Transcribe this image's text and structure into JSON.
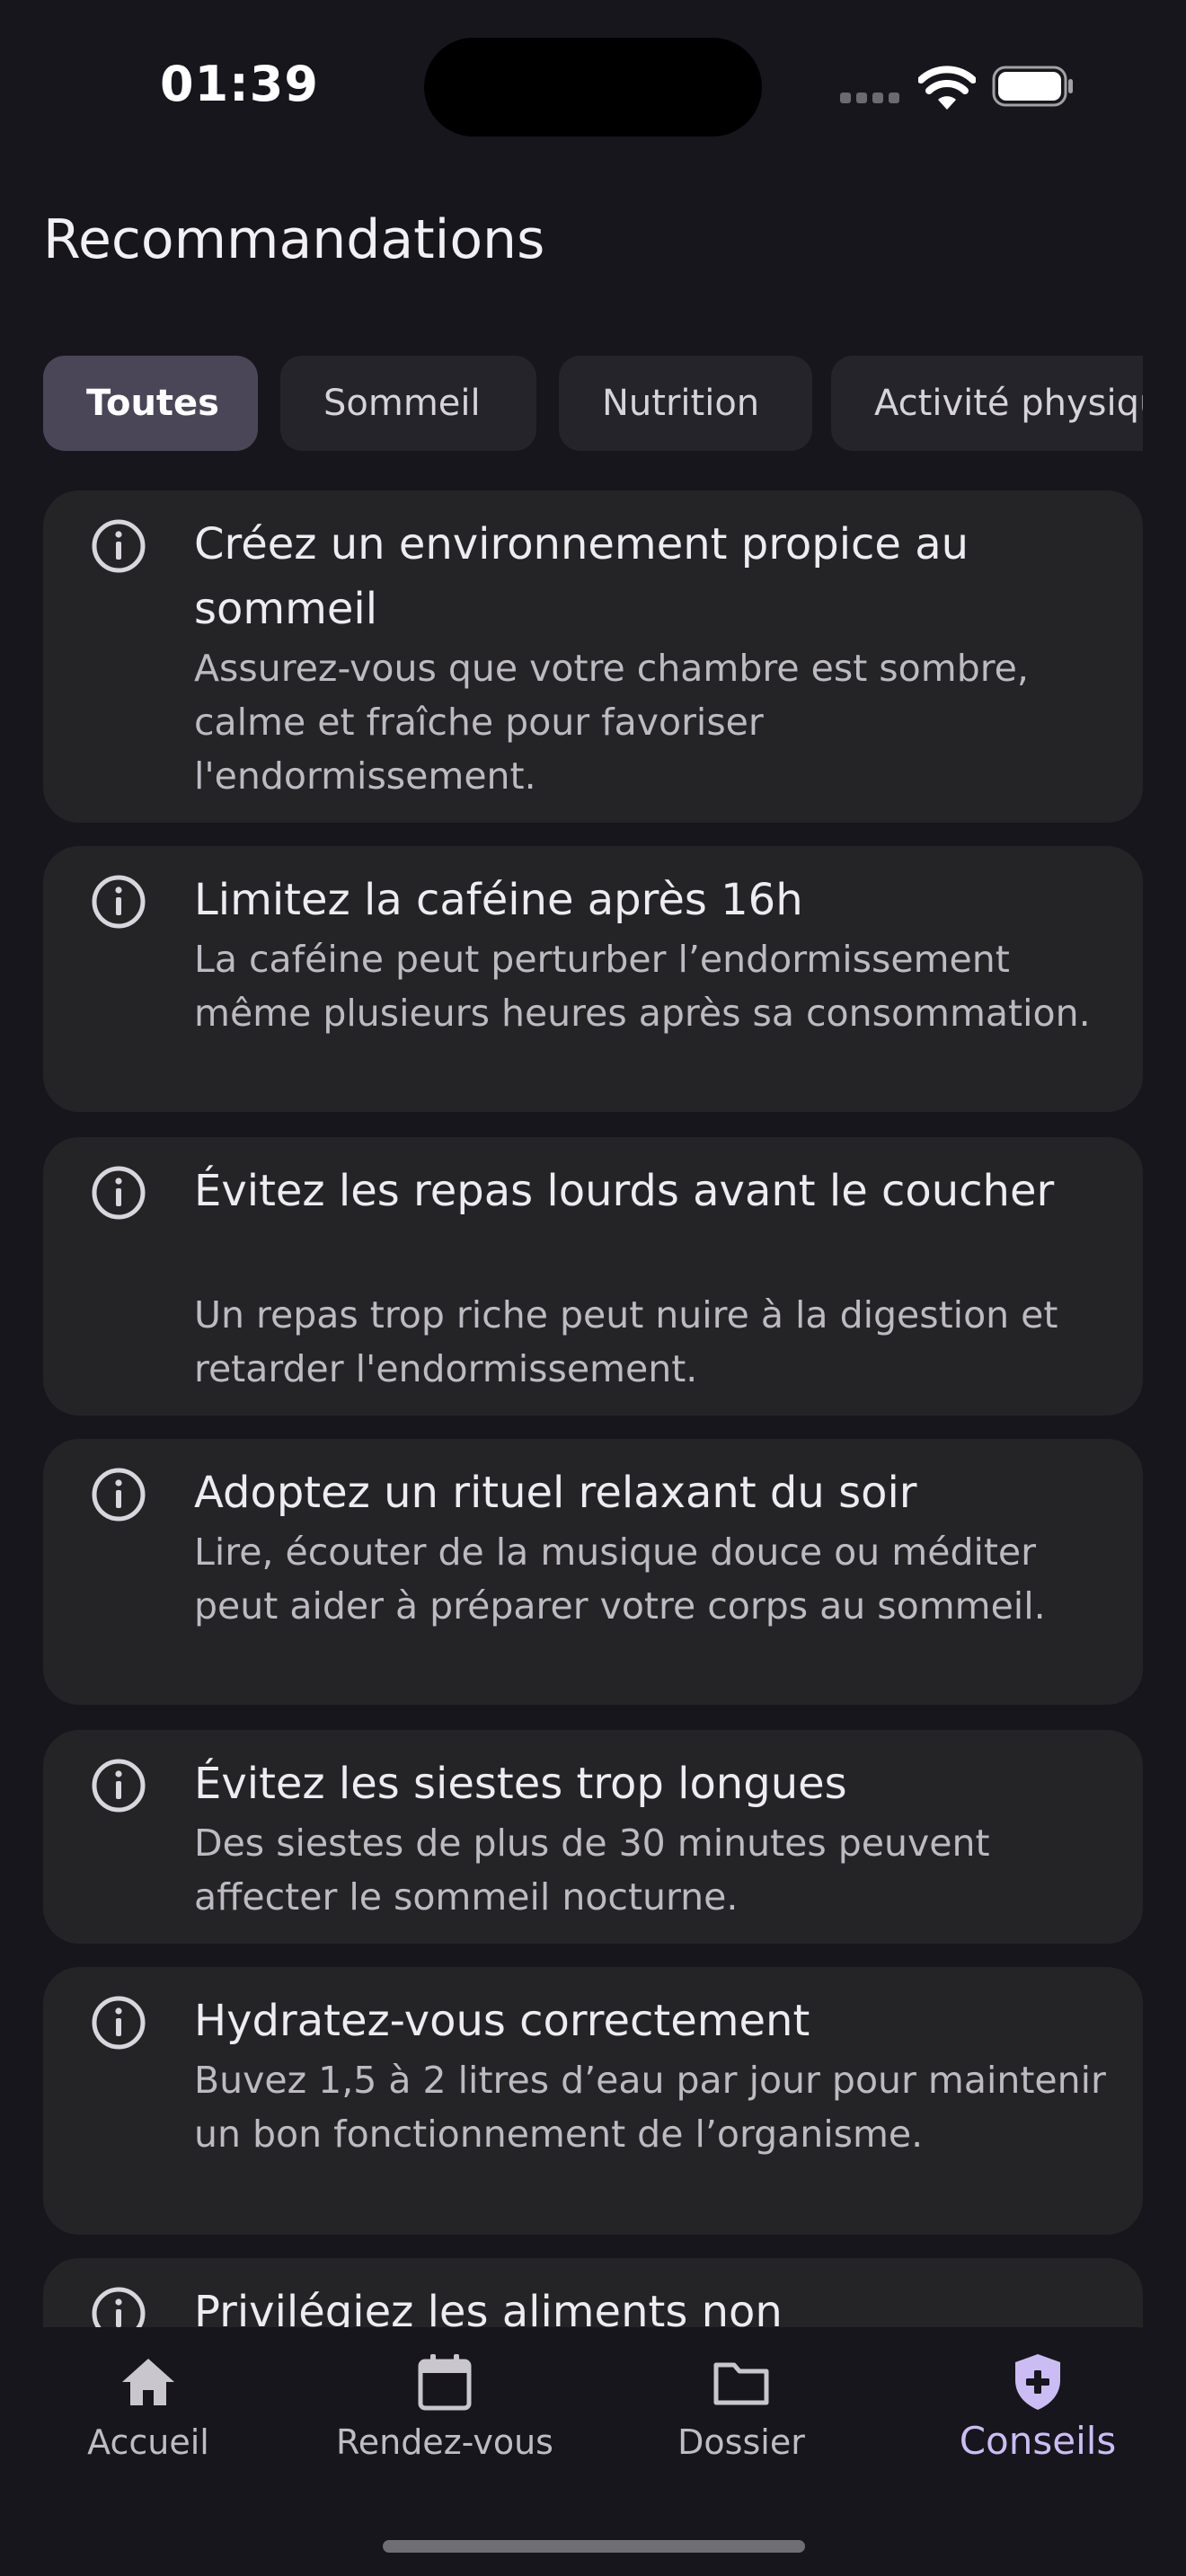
{
  "status": {
    "time": "01:39"
  },
  "page": {
    "title": "Recommandations"
  },
  "filters": [
    {
      "label": "Toutes",
      "active": true
    },
    {
      "label": "Sommeil",
      "active": false
    },
    {
      "label": "Nutrition",
      "active": false
    },
    {
      "label": "Activité physique",
      "active": false
    }
  ],
  "recommendations": [
    {
      "icon": "info-icon",
      "title": "Créez un environnement propice au sommeil",
      "description": "Assurez-vous que votre chambre est sombre, calme et fraîche pour favoriser l'endormissement."
    },
    {
      "icon": "info-icon",
      "title": "Limitez la caféine après 16h",
      "description": "La caféine peut perturber l’endormissement même plusieurs heures après sa consommation."
    },
    {
      "icon": "info-icon",
      "title": "Évitez les repas lourds avant le coucher",
      "description": "Un repas trop riche peut nuire à la digestion et retarder l'endormissement."
    },
    {
      "icon": "info-icon",
      "title": "Adoptez un rituel relaxant du soir",
      "description": "Lire, écouter de la musique douce ou méditer peut aider à préparer votre corps au sommeil."
    },
    {
      "icon": "info-icon",
      "title": "Évitez les siestes trop longues",
      "description": "Des siestes de plus de 30 minutes peuvent affecter le sommeil nocturne."
    },
    {
      "icon": "info-icon",
      "title": "Hydratez-vous correctement",
      "description": "Buvez 1,5 à 2 litres d’eau par jour pour maintenir un bon fonctionnement de l’organisme."
    },
    {
      "icon": "info-icon",
      "title": "Privilégiez les aliments non",
      "description": ""
    }
  ],
  "nav": [
    {
      "label": "Accueil",
      "icon": "home-icon",
      "active": false
    },
    {
      "label": "Rendez-vous",
      "icon": "calendar-icon",
      "active": false
    },
    {
      "label": "Dossier",
      "icon": "folder-icon",
      "active": false
    },
    {
      "label": "Conseils",
      "icon": "shield-plus-icon",
      "active": true
    }
  ],
  "colors": {
    "background": "#17161d",
    "card": "#242426",
    "chip_active": "#4a4658",
    "accent": "#cbbdf4"
  }
}
